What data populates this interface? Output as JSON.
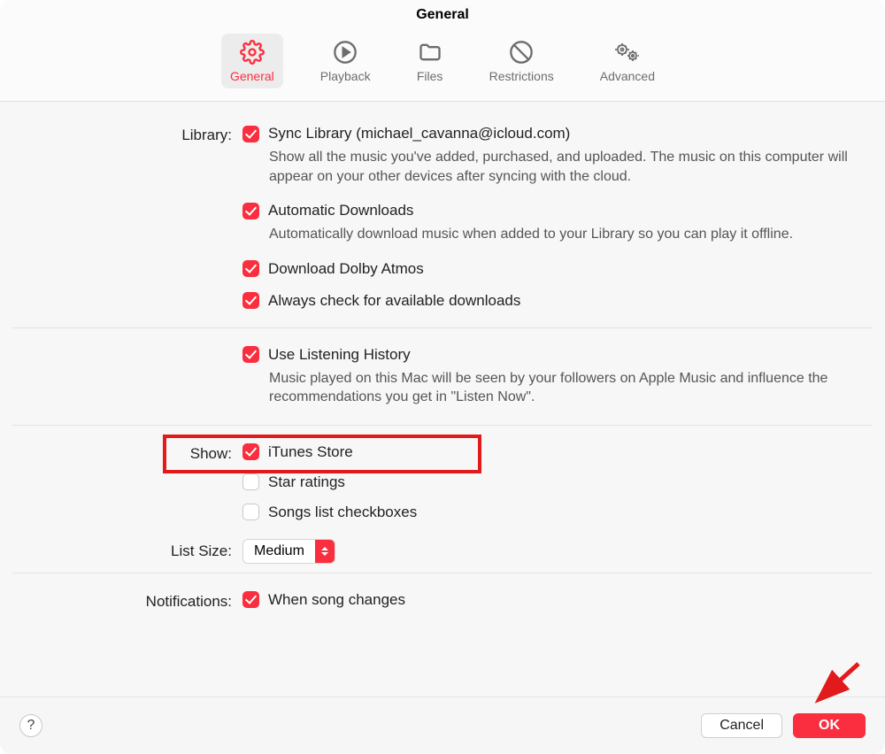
{
  "title": "General",
  "tabs": [
    {
      "label": "General",
      "icon": "gear",
      "active": true
    },
    {
      "label": "Playback",
      "icon": "play",
      "active": false
    },
    {
      "label": "Files",
      "icon": "folder",
      "active": false
    },
    {
      "label": "Restrictions",
      "icon": "nosign",
      "active": false
    },
    {
      "label": "Advanced",
      "icon": "gears",
      "active": false
    }
  ],
  "sections": {
    "library": {
      "label": "Library:",
      "sync_label": "Sync Library (michael_cavanna@icloud.com)",
      "sync_desc": "Show all the music you've added, purchased, and uploaded. The music on this computer will appear on your other devices after syncing with the cloud.",
      "auto_label": "Automatic Downloads",
      "auto_desc": "Automatically download music when added to your Library so you can play it offline.",
      "dolby_label": "Download Dolby Atmos",
      "always_label": "Always check for available downloads",
      "history_label": "Use Listening History",
      "history_desc": "Music played on this Mac will be seen by your followers on Apple Music and influence the recommendations you get in \"Listen Now\"."
    },
    "show": {
      "label": "Show:",
      "itunes_label": "iTunes Store",
      "star_label": "Star ratings",
      "songs_label": "Songs list checkboxes"
    },
    "listsize": {
      "label": "List Size:",
      "value": "Medium"
    },
    "notifications": {
      "label": "Notifications:",
      "song_label": "When song changes"
    }
  },
  "footer": {
    "help": "?",
    "cancel": "Cancel",
    "ok": "OK"
  }
}
